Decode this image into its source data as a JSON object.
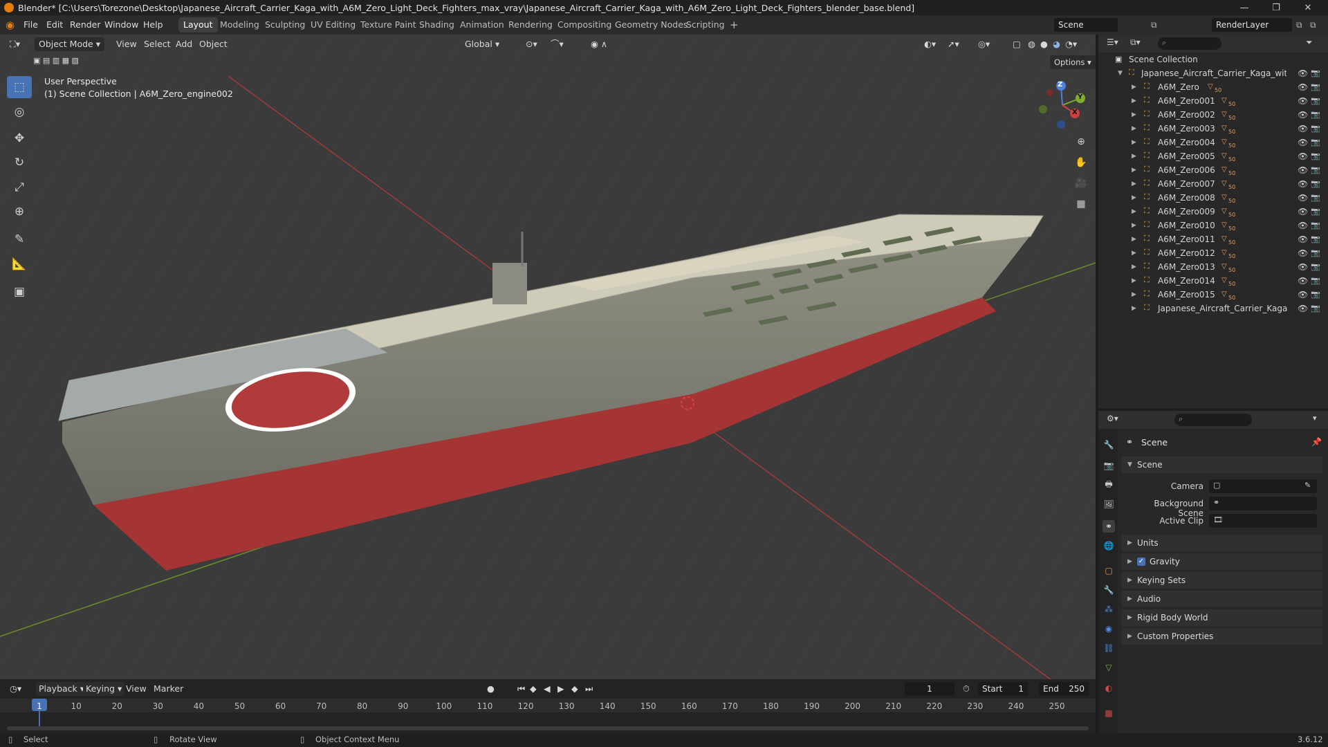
{
  "window": {
    "title": "Blender* [C:\\Users\\Torezone\\Desktop\\Japanese_Aircraft_Carrier_Kaga_with_A6M_Zero_Light_Deck_Fighters_max_vray\\Japanese_Aircraft_Carrier_Kaga_with_A6M_Zero_Light_Deck_Fighters_blender_base.blend]",
    "minimize": "—",
    "maximize": "❐",
    "close": "✕"
  },
  "menus": [
    "File",
    "Edit",
    "Render",
    "Window",
    "Help"
  ],
  "workspaces": [
    "Layout",
    "Modeling",
    "Sculpting",
    "UV Editing",
    "Texture Paint",
    "Shading",
    "Animation",
    "Rendering",
    "Compositing",
    "Geometry Nodes",
    "Scripting",
    "+"
  ],
  "active_workspace": "Layout",
  "scene_field": "Scene",
  "renderlayer_field": "RenderLayer",
  "viewport": {
    "mode": "Object Mode",
    "menus": [
      "View",
      "Select",
      "Add",
      "Object"
    ],
    "orientation": "Global",
    "options": "Options",
    "perspective": "User Perspective",
    "collection_info": "(1) Scene Collection | A6M_Zero_engine002",
    "gizmo": {
      "z": "Z",
      "y": "Y",
      "x": "X"
    }
  },
  "outliner": {
    "root": "Scene Collection",
    "collection": "Japanese_Aircraft_Carrier_Kaga_with_Al",
    "items": [
      "A6M_Zero",
      "A6M_Zero001",
      "A6M_Zero002",
      "A6M_Zero003",
      "A6M_Zero004",
      "A6M_Zero005",
      "A6M_Zero006",
      "A6M_Zero007",
      "A6M_Zero008",
      "A6M_Zero009",
      "A6M_Zero010",
      "A6M_Zero011",
      "A6M_Zero012",
      "A6M_Zero013",
      "A6M_Zero014",
      "A6M_Zero015",
      "Japanese_Aircraft_Carrier_Kaga"
    ],
    "badge": "50"
  },
  "properties": {
    "context": "Scene",
    "section": "Scene",
    "camera_label": "Camera",
    "background_label": "Background Scene",
    "clip_label": "Active Clip",
    "subsections": [
      "Units",
      "Gravity",
      "Keying Sets",
      "Audio",
      "Rigid Body World",
      "Custom Properties"
    ],
    "gravity_checked": true
  },
  "timeline": {
    "menus": [
      "Playback",
      "Keying",
      "View",
      "Marker"
    ],
    "current_frame": "1",
    "start_label": "Start",
    "start": "1",
    "end_label": "End",
    "end": "250",
    "ticks": [
      "1",
      "10",
      "20",
      "30",
      "40",
      "50",
      "60",
      "70",
      "80",
      "90",
      "100",
      "110",
      "120",
      "130",
      "140",
      "150",
      "160",
      "170",
      "180",
      "190",
      "200",
      "210",
      "220",
      "230",
      "240",
      "250"
    ]
  },
  "statusbar": {
    "select": "Select",
    "rotate": "Rotate View",
    "context_menu": "Object Context Menu",
    "version": "3.6.12"
  },
  "colors": {
    "accent": "#4772b3",
    "orange": "#e3a254",
    "hull_red": "#b03a3a",
    "deck": "#d8d2bd"
  }
}
